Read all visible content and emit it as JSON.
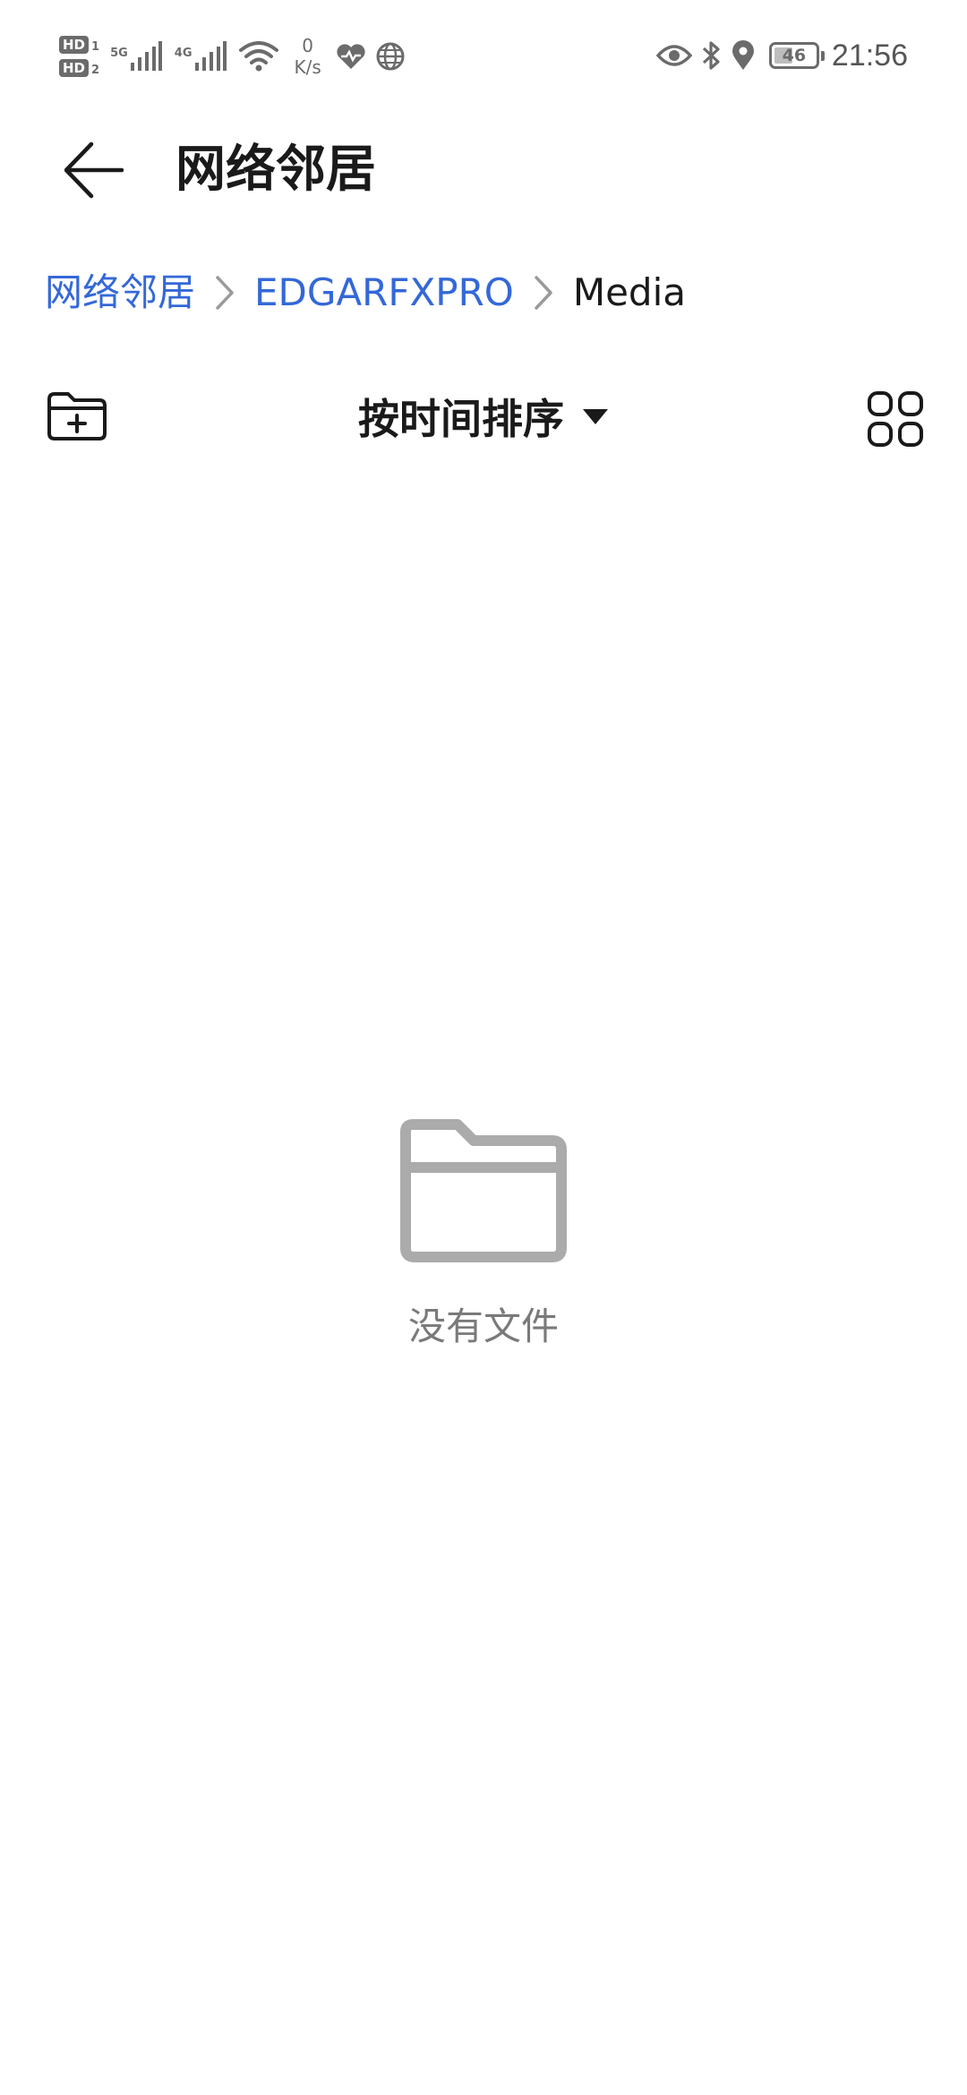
{
  "status_bar": {
    "hd1": "HD",
    "hd1_sub": "1",
    "hd2": "HD",
    "hd2_sub": "2",
    "net1": "5G",
    "net2": "4G",
    "speed_value": "0",
    "speed_unit": "K/s",
    "battery": "46",
    "battery_level": 0.46,
    "time": "21:56",
    "icons": [
      "signal-icon",
      "wifi-icon",
      "health-icon",
      "vpn-icon",
      "eye-icon",
      "bluetooth-icon",
      "location-icon",
      "battery-icon"
    ]
  },
  "header": {
    "title": "网络邻居"
  },
  "breadcrumb": {
    "items": [
      {
        "label": "网络邻居"
      },
      {
        "label": "EDGARFXPRO"
      },
      {
        "label": "Media"
      }
    ]
  },
  "toolbar": {
    "sort_label": "按时间排序",
    "icons": [
      "new-folder-icon",
      "dropdown-caret-icon",
      "grid-view-icon"
    ]
  },
  "empty_state": {
    "message": "没有文件",
    "icon": "folder-icon"
  },
  "colors": {
    "link": "#3468d8",
    "text": "#1a1a1a",
    "muted": "#7a7a7a",
    "icon_gray": "#ababab",
    "background": "#ffffff"
  }
}
